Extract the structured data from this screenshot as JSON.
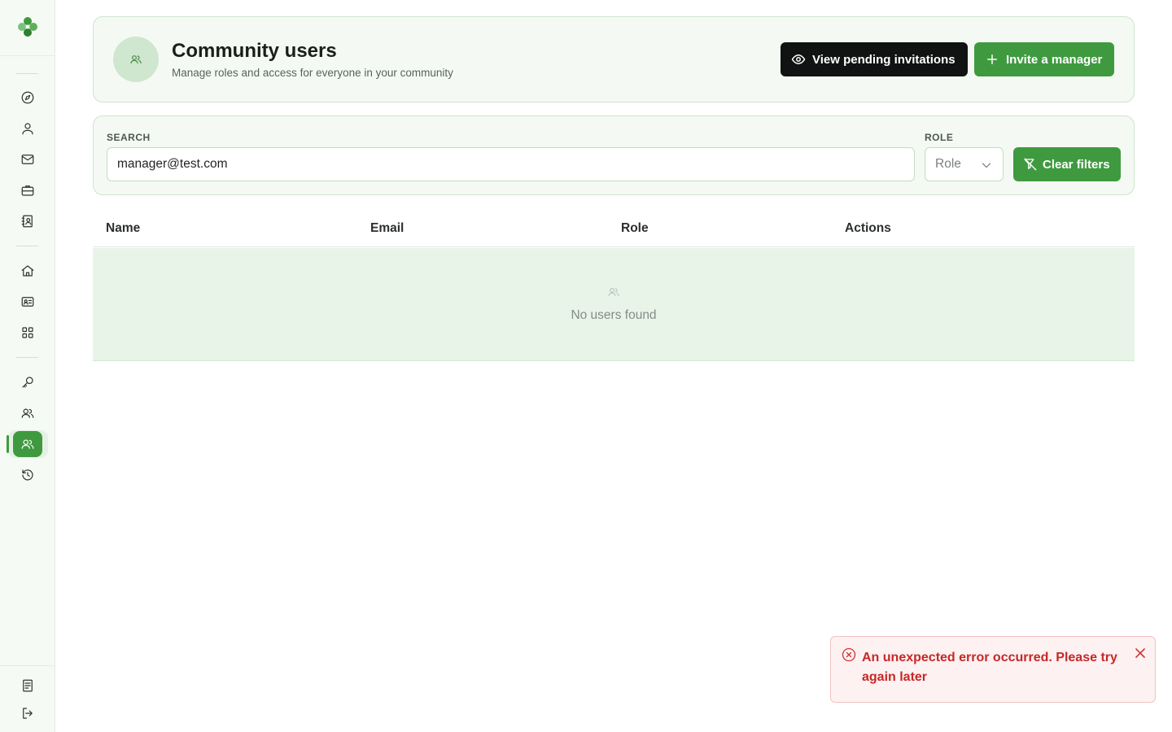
{
  "sidebar": {
    "logo": "clover-logo",
    "items": [
      {
        "icon": "compass-icon"
      },
      {
        "icon": "user-icon"
      },
      {
        "icon": "mail-icon"
      },
      {
        "icon": "briefcase-icon"
      },
      {
        "icon": "contact-book-icon"
      },
      {
        "icon": "home-icon"
      },
      {
        "icon": "id-card-icon"
      },
      {
        "icon": "grid-icon"
      },
      {
        "icon": "key-icon"
      },
      {
        "icon": "users-icon"
      },
      {
        "icon": "community-users-icon",
        "active": true
      },
      {
        "icon": "history-icon"
      },
      {
        "icon": "document-icon"
      },
      {
        "icon": "logout-icon"
      }
    ]
  },
  "header": {
    "title": "Community users",
    "subtitle": "Manage roles and access for everyone in your community",
    "pending_button": "View pending invitations",
    "invite_button": "Invite a manager"
  },
  "filters": {
    "search_label": "SEARCH",
    "search_value": "manager@test.com",
    "role_label": "ROLE",
    "role_placeholder": "Role",
    "clear_button": "Clear filters"
  },
  "table": {
    "columns": [
      "Name",
      "Email",
      "Role",
      "Actions"
    ],
    "empty_text": "No users found"
  },
  "toast": {
    "message": "An unexpected error occurred. Please try again later",
    "type": "error"
  },
  "colors": {
    "accent": "#3f9a3f",
    "dark_button": "#101312",
    "error": "#c62828",
    "card_bg": "#f4faf3"
  }
}
